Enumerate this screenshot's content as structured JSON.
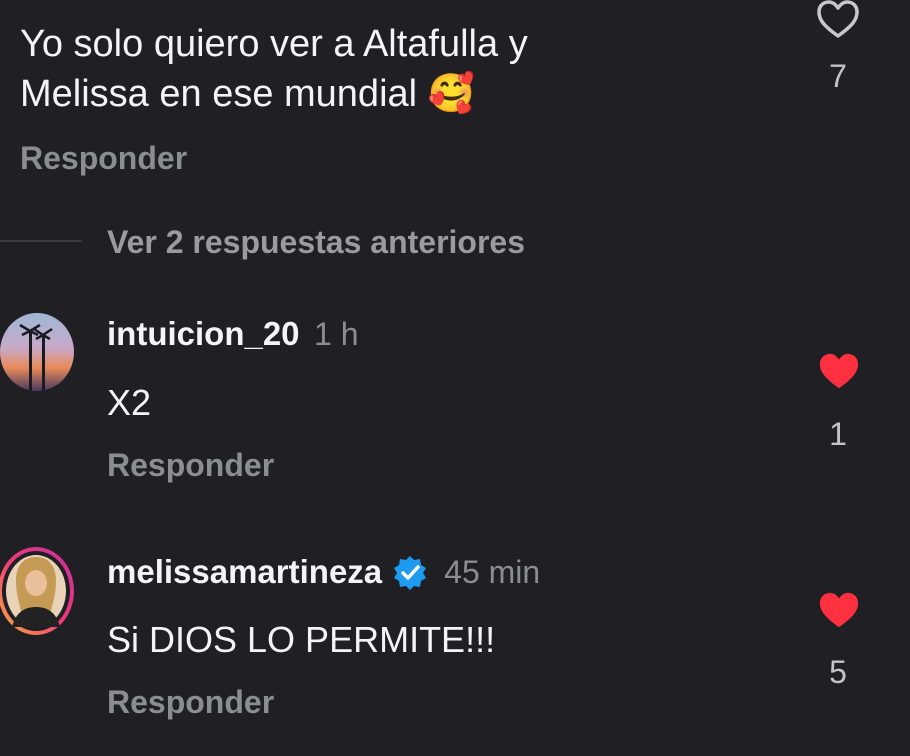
{
  "comment_main": {
    "text_line1": "Yo solo quiero ver a Altafulla y",
    "text_line2": "Melissa en ese mundial",
    "emoji": "🥰",
    "reply_label": "Responder",
    "like_count": "7",
    "like_icon": "heart-outline-icon"
  },
  "view_replies": {
    "label": "Ver 2 respuestas anteriores"
  },
  "replies": [
    {
      "username": "intuicion_20",
      "time": "1 h",
      "text": "X2",
      "reply_label": "Responder",
      "like_count": "1",
      "liked": true,
      "like_color": "#ff3040"
    },
    {
      "username": "melissamartineza",
      "verified": true,
      "verified_color": "#1d9bf0",
      "time": "45 min",
      "text": "Si DIOS LO PERMITE!!!",
      "reply_label": "Responder",
      "like_count": "5",
      "liked": true,
      "like_color": "#ff3040"
    }
  ]
}
